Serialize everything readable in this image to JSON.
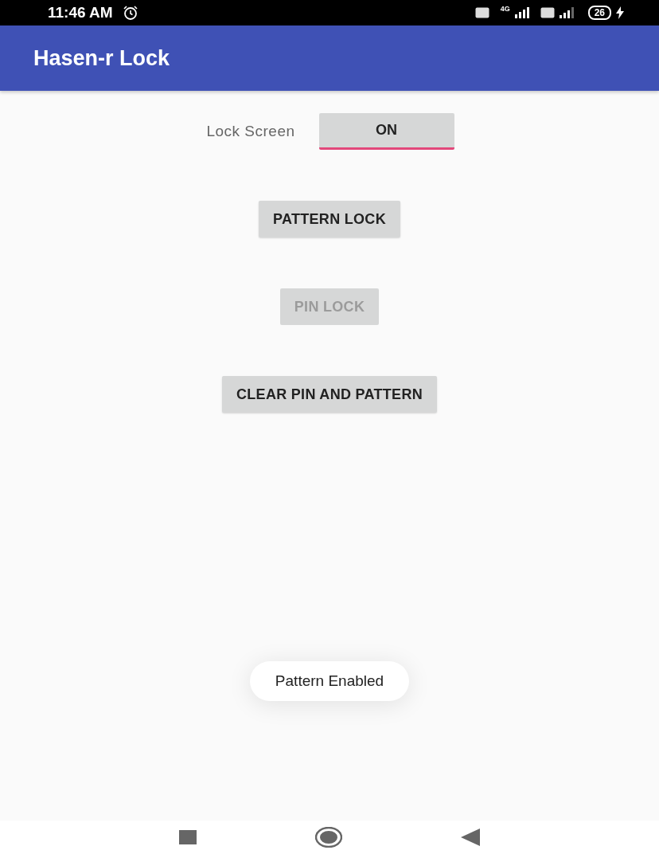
{
  "status_bar": {
    "time": "11:46 AM",
    "battery": "26",
    "network": "4G"
  },
  "app_bar": {
    "title": "Hasen-r Lock"
  },
  "lock_screen": {
    "label": "Lock Screen",
    "toggle_text": "ON",
    "checked": true
  },
  "buttons": [
    {
      "label": "PATTERN LOCK",
      "disabled": false
    },
    {
      "label": "PIN LOCK",
      "disabled": true
    },
    {
      "label": "CLEAR PIN AND PATTERN",
      "disabled": false
    }
  ],
  "toast": {
    "message": "Pattern Enabled"
  }
}
